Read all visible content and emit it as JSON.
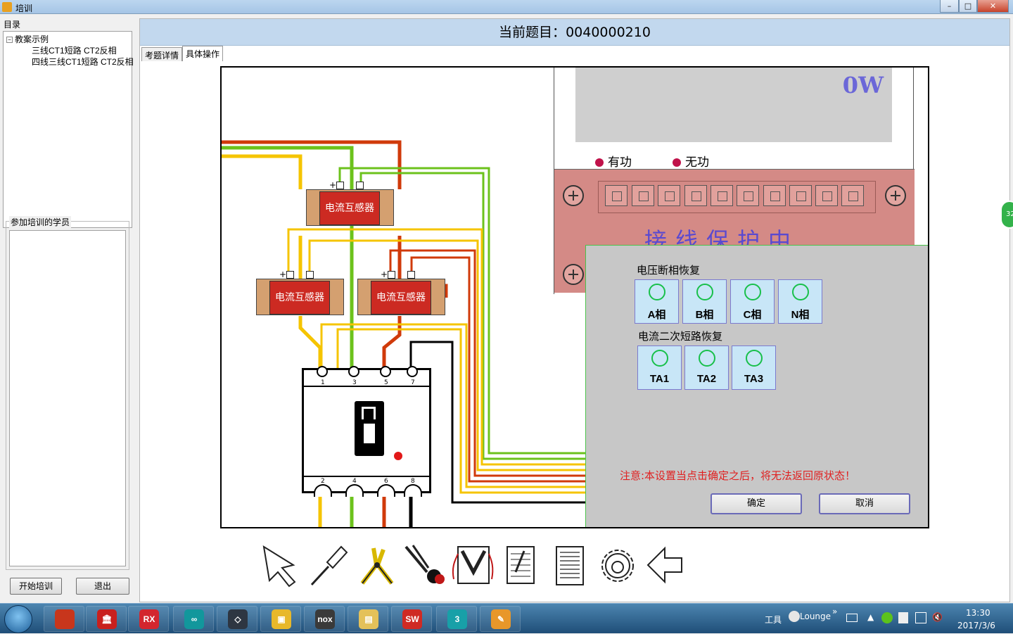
{
  "window": {
    "title": "培训",
    "minimize": "–",
    "maximize": "□",
    "close": "✕"
  },
  "sidebar": {
    "catalog_label": "目录",
    "tree_root": "教案示例",
    "tree_items": [
      "三线CT1短路  CT2反相",
      "四线三线CT1短路  CT2反相"
    ],
    "students_label": "参加培训的学员",
    "start_button": "开始培训",
    "exit_button": "退出"
  },
  "main": {
    "question_prefix": "当前题目：",
    "question_id": "0040000210",
    "tabs": [
      "考题详情",
      "具体操作"
    ]
  },
  "diagram": {
    "ct_label": "电流互感器",
    "ct_plus": "+",
    "breaker_top_terminals": [
      "1",
      "3",
      "5",
      "7"
    ],
    "breaker_bottom_terminals": [
      "2",
      "4",
      "6",
      "8"
    ],
    "meter_reading": "0W",
    "active_label": "有功",
    "reactive_label": "无功",
    "protect_text": "接线保护中",
    "wire_colors": {
      "yellow": "#f5c400",
      "green": "#6cc21c",
      "red": "#d03a0a",
      "black": "#000000"
    }
  },
  "dialog": {
    "voltage_section": "电压断相恢复",
    "voltage_buttons": [
      "A相",
      "B相",
      "C相",
      "N相"
    ],
    "current_section": "电流二次短路恢复",
    "current_buttons": [
      "TA1",
      "TA2",
      "TA3"
    ],
    "warning": "注意:本设置当点击确定之后，将无法返回原状态！",
    "confirm": "确定",
    "cancel": "取消"
  },
  "tools": [
    "pointer-icon",
    "screwdriver-icon",
    "wire-stripper-icon",
    "pliers-icon",
    "multimeter-icon",
    "notepad-icon",
    "document-icon",
    "gear-icon",
    "back-arrow-icon"
  ],
  "side_badge": "32",
  "taskbar": {
    "apps": [
      {
        "name": "spartan-app",
        "label": "",
        "color": "#c8361c"
      },
      {
        "name": "museum-app",
        "label": "🏛",
        "color": "#c9201e"
      },
      {
        "name": "rx-app",
        "label": "RX",
        "color": "#d3262e"
      },
      {
        "name": "arduino-app",
        "label": "∞",
        "color": "#12979c"
      },
      {
        "name": "unity-app",
        "label": "◇",
        "color": "#2e3642"
      },
      {
        "name": "note-app",
        "label": "▣",
        "color": "#e8b82a"
      },
      {
        "name": "nox-app",
        "label": "nox",
        "color": "#3a3a3a"
      },
      {
        "name": "explorer-app",
        "label": "▤",
        "color": "#e4c15a"
      },
      {
        "name": "solidworks-app",
        "label": "SW",
        "color": "#cf2a24"
      },
      {
        "name": "3dsmax-app",
        "label": "3",
        "color": "#18a0a8"
      },
      {
        "name": "trainer-app",
        "label": "✎",
        "color": "#e8972a"
      }
    ],
    "tray_tools": "工具",
    "tray_lounge": "Lounge",
    "tray_more": "»",
    "time": "13:30",
    "date": "2017/3/6"
  }
}
